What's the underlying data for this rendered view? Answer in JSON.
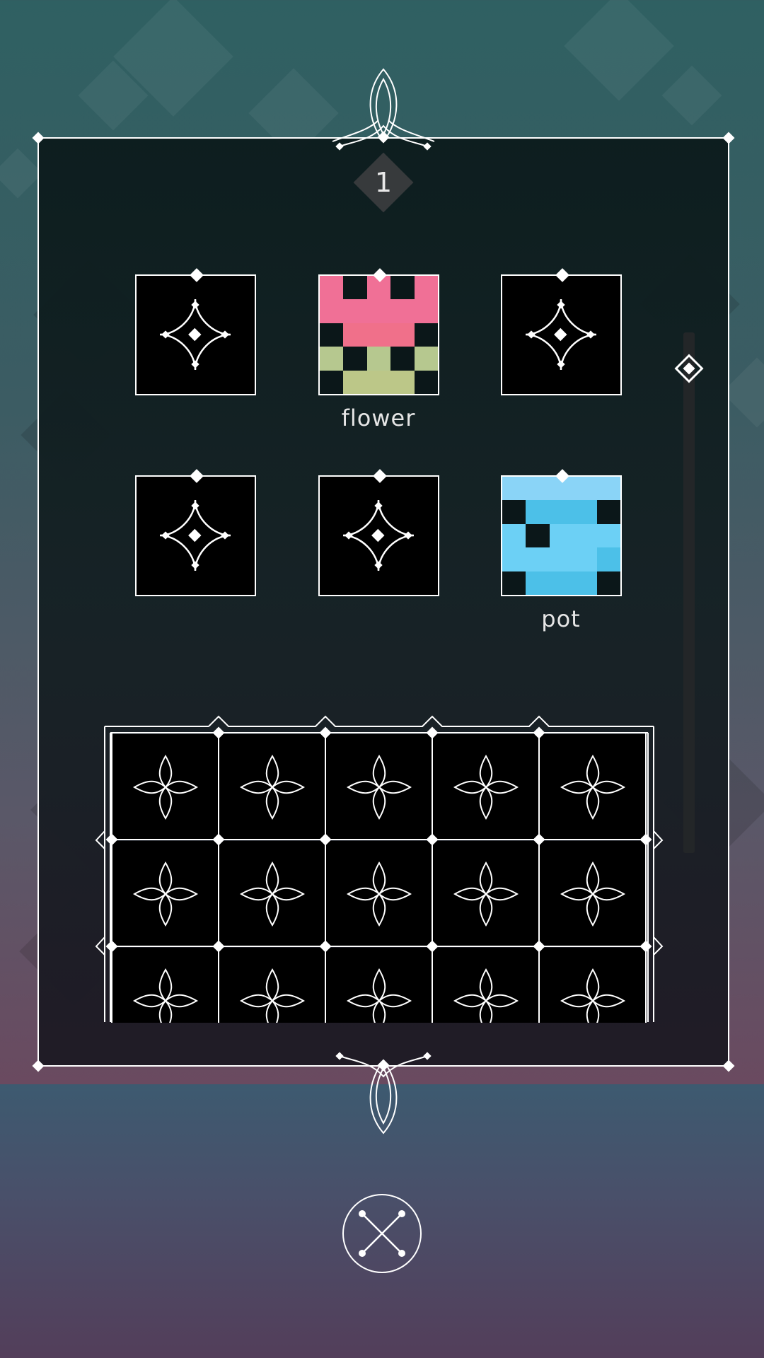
{
  "level": {
    "number": "1"
  },
  "recipe_slots": [
    {
      "label": "",
      "filled": false
    },
    {
      "label": "flower",
      "filled": true,
      "pixels": [
        "#f07096",
        "#0b1719",
        "#f07096",
        "#0b1719",
        "#f07096",
        "#f07096",
        "#f07096",
        "#f07096",
        "#f07096",
        "#f07096",
        "#0b1719",
        "#f0708a",
        "#f0708a",
        "#f0708a",
        "#0b1719",
        "#b6c88f",
        "#0b1719",
        "#b6c88f",
        "#0b1719",
        "#b6c88f",
        "#0b1719",
        "#bcc788",
        "#bcc788",
        "#bcc788",
        "#0b1719"
      ]
    },
    {
      "label": "",
      "filled": false
    },
    {
      "label": "",
      "filled": false
    },
    {
      "label": "",
      "filled": false
    },
    {
      "label": "pot",
      "filled": true,
      "pixels": [
        "#8ad4f7",
        "#8ad4f7",
        "#8ad4f7",
        "#8ad4f7",
        "#8ad4f7",
        "#0b1719",
        "#4cc0e8",
        "#4cc0e8",
        "#4cc0e8",
        "#0b1719",
        "#6cd0f5",
        "#0b1719",
        "#6cd0f5",
        "#6cd0f5",
        "#6cd0f5",
        "#6cd0f5",
        "#6cd0f5",
        "#6cd0f5",
        "#6cd0f5",
        "#4cc0e8",
        "#0b1719",
        "#4cc0e8",
        "#4cc0e8",
        "#4cc0e8",
        "#0b1719"
      ]
    }
  ],
  "inventory": {
    "columns": 5,
    "visible_rows": 3
  },
  "colors": {
    "accent": "#ffffff",
    "panel": "#0f1c1e",
    "badge": "#373a3c"
  },
  "icons": {
    "empty_slot": "four-point-star-icon",
    "inventory_slot": "four-petal-icon",
    "close": "close-x-icon",
    "scroll_thumb": "diamond-icon"
  }
}
